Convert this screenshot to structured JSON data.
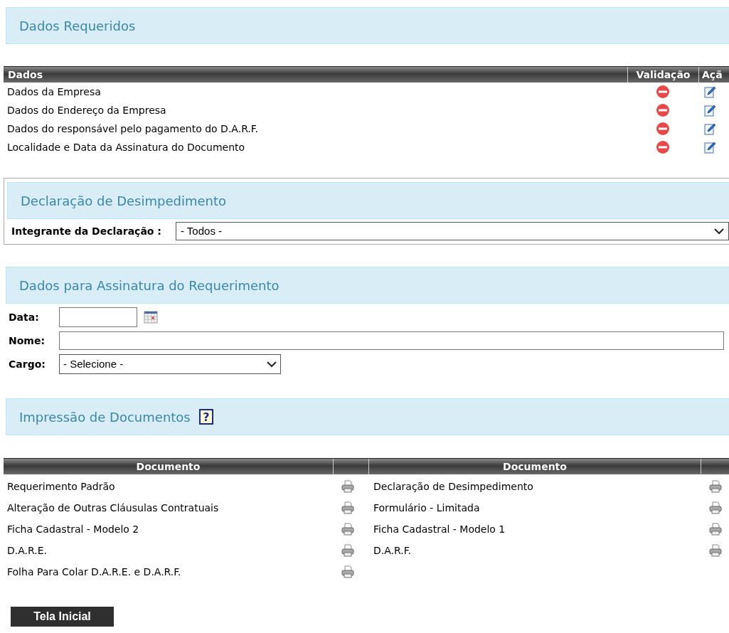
{
  "required_section": {
    "title": "Dados Requeridos"
  },
  "required_table": {
    "columns": [
      "Dados",
      "Validação",
      "Açã"
    ],
    "rows": [
      {
        "label": "Dados da Empresa",
        "valid": false
      },
      {
        "label": "Dados do Endereço da Empresa",
        "valid": false
      },
      {
        "label": "Dados do responsável pelo pagamento do D.A.R.F.",
        "valid": false
      },
      {
        "label": "Localidade e Data da Assinatura do Documento",
        "valid": false
      }
    ]
  },
  "declaration_section": {
    "title": "Declaração de Desimpedimento",
    "field_label": "Integrante da Declaração :",
    "select_value": "- Todos -"
  },
  "signature_section": {
    "title": "Dados para Assinatura do Requerimento",
    "fields": [
      {
        "kind": "date",
        "label": "Data:"
      },
      {
        "kind": "text",
        "label": "Nome:"
      },
      {
        "kind": "select",
        "label": "Cargo:",
        "value": "- Selecione -"
      }
    ]
  },
  "print_section": {
    "title": "Impressão de Documentos",
    "help_label": "?",
    "columns": [
      "Documento",
      "Documento"
    ],
    "documents": [
      [
        "Requerimento Padrão",
        "Declaração de Desimpedimento"
      ],
      [
        "Alteração de Outras Cláusulas Contratuais",
        "Formulário - Limitada"
      ],
      [
        "Ficha Cadastral - Modelo 2",
        "Ficha Cadastral - Modelo 1"
      ],
      [
        "D.A.R.E.",
        "D.A.R.F."
      ],
      [
        "Folha Para Colar D.A.R.E. e D.A.R.F."
      ]
    ]
  },
  "home_button": "Tela Inicial"
}
